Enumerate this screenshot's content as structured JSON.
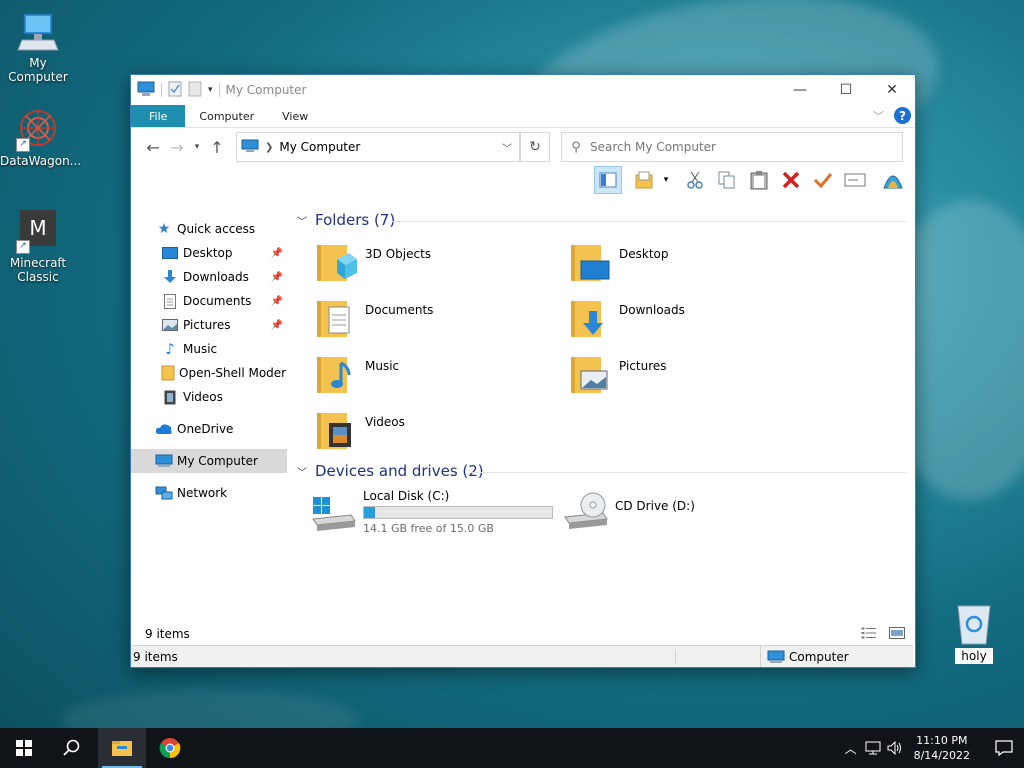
{
  "desktop": {
    "icons": [
      {
        "label": "My Computer"
      },
      {
        "label": "DataWagon..."
      },
      {
        "label": "Minecraft Classic",
        "glyph": "M"
      },
      {
        "label": "holy"
      }
    ]
  },
  "window": {
    "title": "My Computer",
    "ribbon_tabs": [
      "File",
      "Computer",
      "View"
    ],
    "address": {
      "path": "My Computer"
    },
    "search": {
      "placeholder": "Search My Computer"
    },
    "nav": {
      "quick_access": "Quick access",
      "quick_items": [
        "Desktop",
        "Downloads",
        "Documents",
        "Pictures",
        "Music",
        "Open-Shell Modern",
        "Videos"
      ],
      "onedrive": "OneDrive",
      "my_computer": "My Computer",
      "network": "Network"
    },
    "folders_header": "Folders (7)",
    "folders": [
      "3D Objects",
      "Desktop",
      "Documents",
      "Downloads",
      "Music",
      "Pictures",
      "Videos"
    ],
    "devices_header": "Devices and drives (2)",
    "drives": [
      {
        "name": "Local Disk (C:)",
        "free_text": "14.1 GB free of 15.0 GB",
        "used_fraction": 0.06
      },
      {
        "name": "CD Drive (D:)"
      }
    ],
    "status": {
      "items": "9 items",
      "items2": "9 items",
      "location": "Computer"
    }
  },
  "taskbar": {
    "time": "11:10 PM",
    "date": "8/14/2022"
  },
  "colors": {
    "accent": "#1e8fae",
    "folder": "#f4c24e",
    "header": "#1e3287",
    "drive_fill": "#26a0da"
  }
}
